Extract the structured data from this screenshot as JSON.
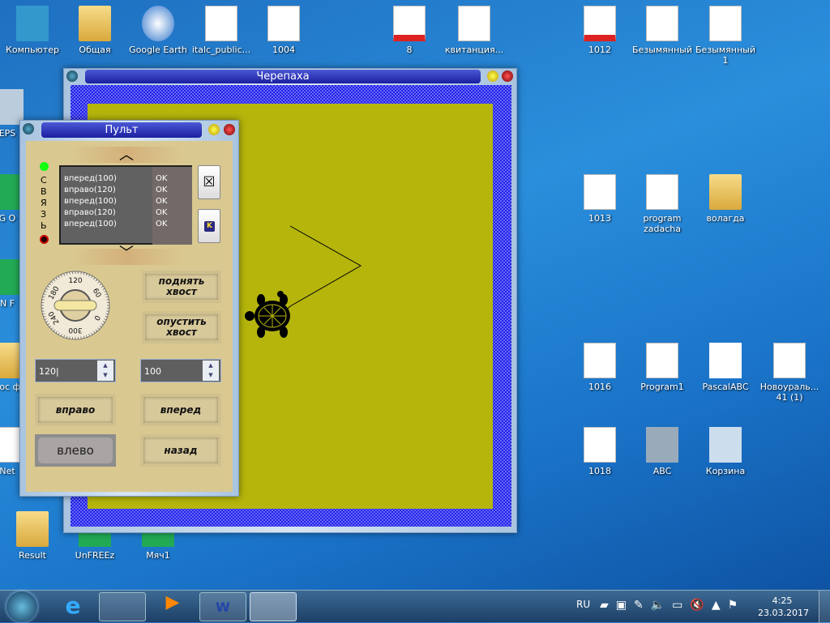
{
  "desktop_icons": [
    {
      "label": "Компьютер",
      "type": "computer"
    },
    {
      "label": "Общая",
      "type": "folder"
    },
    {
      "label": "Google Earth",
      "type": "globe"
    },
    {
      "label": "italc_public...",
      "type": "doc"
    },
    {
      "label": "1004",
      "type": "doc"
    },
    {
      "label": "8",
      "type": "pdf"
    },
    {
      "label": "квитанция...",
      "type": "doc"
    },
    {
      "label": "1012",
      "type": "pdf"
    },
    {
      "label": "Безымянный",
      "type": "doc"
    },
    {
      "label": "Безымянный 1",
      "type": "doc"
    },
    {
      "label": "1013",
      "type": "doc"
    },
    {
      "label": "program zadacha",
      "type": "word"
    },
    {
      "label": "волагда",
      "type": "folder"
    },
    {
      "label": "1016",
      "type": "doc"
    },
    {
      "label": "Program1",
      "type": "doc"
    },
    {
      "label": "PascalABC",
      "type": "abc"
    },
    {
      "label": "Новоураль... 41 (1)",
      "type": "excel"
    },
    {
      "label": "1018",
      "type": "doc"
    },
    {
      "label": "ABC",
      "type": "gear"
    },
    {
      "label": "Корзина",
      "type": "trash"
    },
    {
      "label": "Result",
      "type": "folder"
    },
    {
      "label": "UnFREEz",
      "type": "app"
    },
    {
      "label": "Мяч1",
      "type": "app"
    },
    {
      "label": "EPS",
      "type": "scanner"
    },
    {
      "label": "G O",
      "type": "app"
    },
    {
      "label": "N F",
      "type": "app"
    },
    {
      "label": "вос ф",
      "type": "folder"
    },
    {
      "label": "Net",
      "type": "doc"
    }
  ],
  "turtle_window": {
    "title": "Черепаха",
    "field_color": "#b5b50c",
    "border_color": "#1a1ae0"
  },
  "control_window": {
    "title": "Пульт",
    "connection_label": [
      "С",
      "В",
      "Я",
      "З",
      "Ь"
    ],
    "log": [
      {
        "cmd": "вперед(100)",
        "status": "OK"
      },
      {
        "cmd": "вправо(120)",
        "status": "OK"
      },
      {
        "cmd": "вперед(100)",
        "status": "OK"
      },
      {
        "cmd": "вправо(120)",
        "status": "OK"
      },
      {
        "cmd": "вперед(100)",
        "status": "OK"
      }
    ],
    "dial": {
      "ticks": [
        "120",
        "60",
        "0",
        "300",
        "240",
        "180"
      ],
      "value": 120
    },
    "raise_tail": "поднять хвост",
    "lower_tail": "опустить хвост",
    "angle_value": "120",
    "distance_value": "100",
    "right": "вправо",
    "forward": "вперед",
    "left": "влево",
    "back": "назад",
    "k_label": "K"
  },
  "taskbar": {
    "lang": "RU",
    "time": "4:25",
    "date": "23.03.2017"
  }
}
